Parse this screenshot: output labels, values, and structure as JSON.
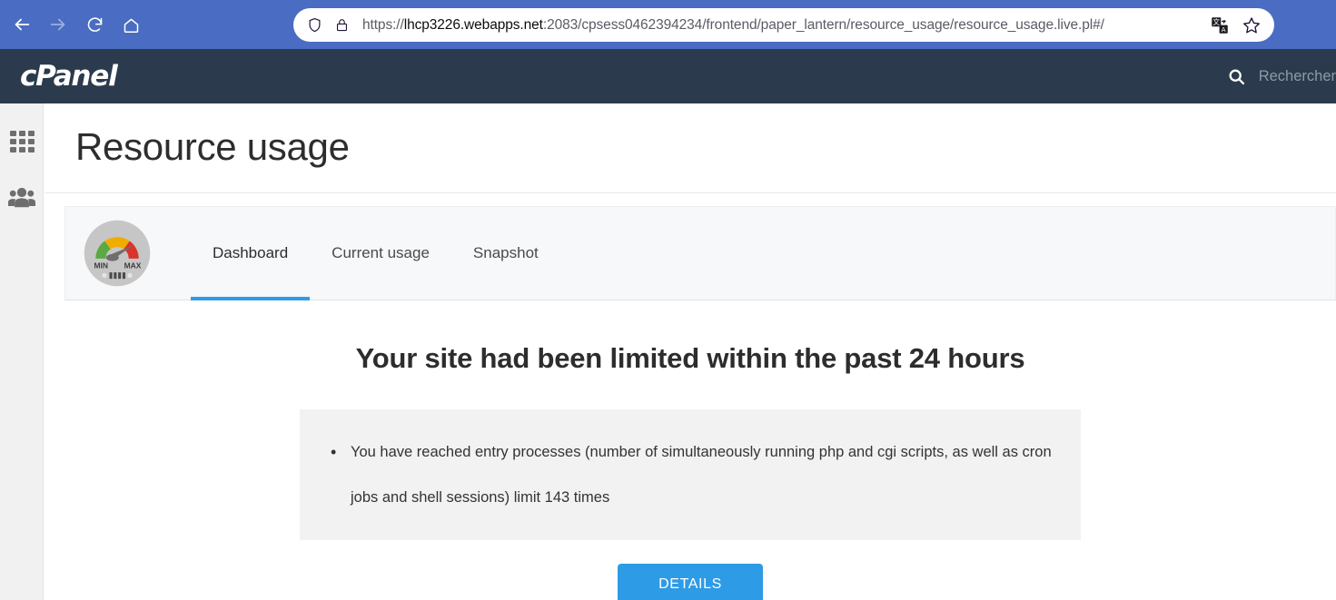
{
  "browser": {
    "back_icon": "back-arrow-icon",
    "forward_icon": "forward-arrow-icon",
    "reload_icon": "reload-icon",
    "home_icon": "home-icon",
    "shield_icon": "shield-icon",
    "lock_icon": "lock-icon",
    "translate_icon": "translate-icon",
    "bookmark_icon": "star-icon",
    "url_scheme": "https://",
    "url_host": "lhcp3226.webapps.net",
    "url_rest": ":2083/cpsess0462394234/frontend/paper_lantern/resource_usage/resource_usage.live.pl#/"
  },
  "header": {
    "logo_text": "cPanel",
    "search_icon": "search-icon",
    "search_placeholder": "Rechercher"
  },
  "sidebar": {
    "items": [
      {
        "name": "apps-grid",
        "icon": "grid-icon"
      },
      {
        "name": "user-manager",
        "icon": "people-icon"
      }
    ]
  },
  "main": {
    "page_title": "Resource usage",
    "gauge_icon": "speedometer-icon",
    "gauge_min_label": "MIN",
    "gauge_max_label": "MAX",
    "tabs": [
      {
        "label": "Dashboard",
        "active": true
      },
      {
        "label": "Current usage",
        "active": false
      },
      {
        "label": "Snapshot",
        "active": false
      }
    ],
    "alert_heading": "Your site had been limited within the past 24 hours",
    "alert_items": [
      "You have reached entry processes (number of simultaneously running php and cgi scripts, as well as cron jobs and shell sessions) limit 143 times"
    ],
    "details_button": "DETAILS"
  },
  "colors": {
    "browser_chrome": "#4a6cc2",
    "cpanel_header": "#2b3b4d",
    "accent_blue": "#2e9be6",
    "sidebar_bg": "#f1f1f1",
    "tabstrip_bg": "#f7f8f9",
    "alert_bg": "#f2f2f2",
    "gauge_green": "#5aa942",
    "gauge_yellow": "#f0ad00",
    "gauge_red": "#d9342b",
    "gauge_body": "#c6c6c6"
  }
}
